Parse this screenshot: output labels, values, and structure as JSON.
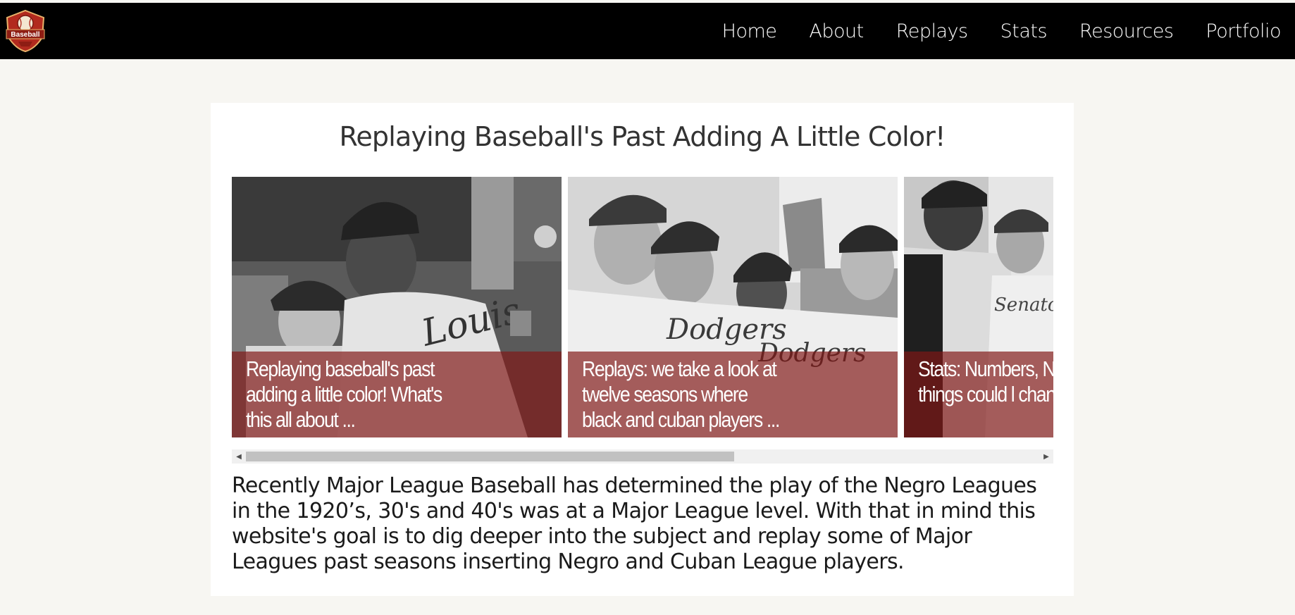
{
  "nav": {
    "logo_text": "Baseball",
    "items": [
      {
        "label": "Home"
      },
      {
        "label": "About"
      },
      {
        "label": "Replays"
      },
      {
        "label": "Stats"
      },
      {
        "label": "Resources"
      },
      {
        "label": "Portfolio"
      }
    ]
  },
  "main": {
    "title": "Replaying Baseball's Past Adding A Little Color!",
    "slides": [
      {
        "caption": "Replaying baseball's past adding a little color! What's this all about ..."
      },
      {
        "caption": "Replays: we take a look at twelve seasons where black and cuban players ..."
      },
      {
        "caption": "Stats: Numbers, N how things could l changed ..."
      }
    ],
    "scrollbar": {
      "position_fraction": 0.0,
      "visible_fraction": 0.6
    },
    "intro": "Recently Major League Baseball has determined the play of the Negro Leagues in the 1920’s, 30's and 40's was at a Major League level. With that in mind this website's goal is to dig deeper into the subject and replay some of Major Leagues past seasons inserting Negro and Cuban League players."
  },
  "colors": {
    "nav_bg": "#000000",
    "caption_overlay": "#801614",
    "page_bg": "#f7f6f2",
    "logo_red": "#b22a1e"
  }
}
